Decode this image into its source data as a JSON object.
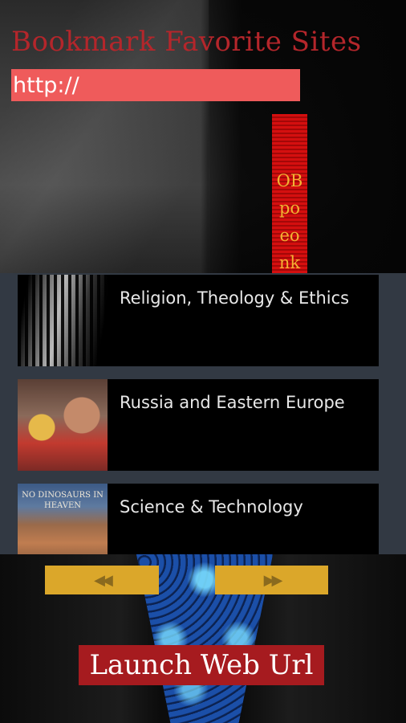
{
  "header": {
    "title": "Bookmark Favorite Sites",
    "url_value": "http://"
  },
  "side_strip": {
    "lines": [
      "OB",
      "po",
      "eo",
      "nk"
    ]
  },
  "list": {
    "items": [
      {
        "label": "Religion, Theology & Ethics"
      },
      {
        "label": "Russia and Eastern Europe"
      },
      {
        "label": "Science & Technology",
        "thumb_text": "NO DINOSAURS IN HEAVEN"
      }
    ]
  },
  "nav": {
    "prev_icon": "rewind-icon",
    "next_icon": "fast-forward-icon"
  },
  "actions": {
    "launch_label": "Launch Web Url"
  },
  "colors": {
    "title": "#b4262b",
    "url_field": "#ef5b5b",
    "strip": "#d40f0f",
    "strip_text": "#f2b233",
    "nav_button": "#dba72a",
    "launch_button": "#a61b1f",
    "list_background": "#323943"
  }
}
